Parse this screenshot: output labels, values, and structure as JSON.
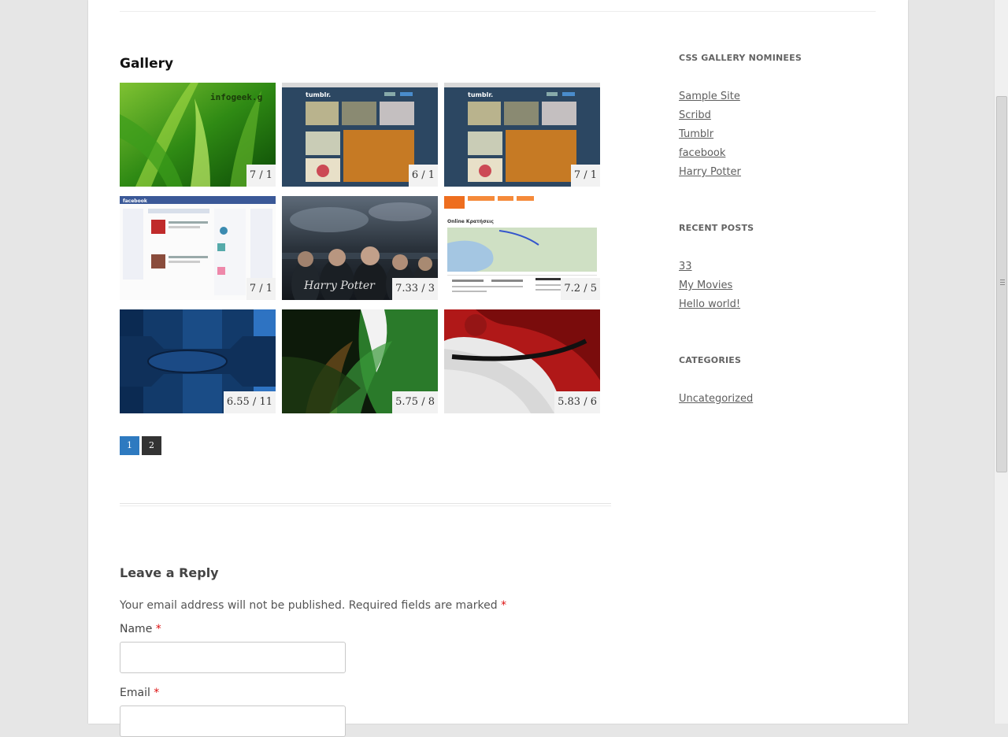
{
  "gallery": {
    "title": "Gallery",
    "items": [
      {
        "name": "infogeek",
        "rating": "7 / 1",
        "caption": "infogeek.g"
      },
      {
        "name": "tumblr",
        "rating": "6 / 1",
        "caption": "tumblr."
      },
      {
        "name": "tumblr-2",
        "rating": "7 / 1",
        "caption": "tumblr."
      },
      {
        "name": "facebook",
        "rating": "7 / 1",
        "caption": "facebook"
      },
      {
        "name": "harry-potter",
        "rating": "7.33 / 3",
        "caption": "Harry Potter"
      },
      {
        "name": "map-site",
        "rating": "7.2 / 5",
        "caption": "Online Κρατήσεις"
      },
      {
        "name": "blue-abstract",
        "rating": "6.55 / 11"
      },
      {
        "name": "green-abstract",
        "rating": "5.75 / 8"
      },
      {
        "name": "red-abstract",
        "rating": "5.83 / 6"
      }
    ],
    "pages": [
      "1",
      "2"
    ],
    "current_page": "1"
  },
  "reply": {
    "title": "Leave a Reply",
    "notes": "Your email address will not be published. Required fields are marked",
    "required_mark": "*",
    "name_label": "Name",
    "email_label": "Email"
  },
  "sidebar": {
    "nominees_title": "CSS GALLERY NOMINEES",
    "nominees": [
      "Sample Site",
      "Scribd",
      "Tumblr",
      "facebook",
      "Harry Potter"
    ],
    "recent_title": "RECENT POSTS",
    "recent": [
      "33",
      "My Movies",
      "Hello world!"
    ],
    "categories_title": "CATEGORIES",
    "categories": [
      "Uncategorized"
    ]
  },
  "colors": {
    "accent": "#2e7ac0",
    "required": "#dd1111",
    "page_bg": "#e6e6e6"
  }
}
